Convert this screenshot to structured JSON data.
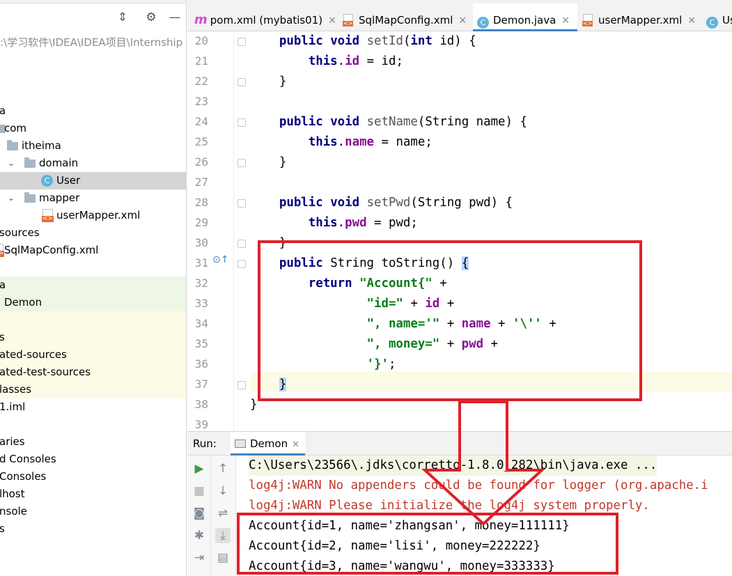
{
  "project": {
    "path": ":\\学习软件\\IDEA\\IDEA项目\\Internship p",
    "tree": [
      {
        "label": "a",
        "chev": "",
        "icon": "none"
      },
      {
        "label": "com",
        "chev": "",
        "icon": "folder"
      },
      {
        "label": "itheima",
        "chev": "",
        "icon": "folder"
      },
      {
        "label": "domain",
        "chev": "⌄",
        "icon": "folder"
      },
      {
        "label": "User",
        "chev": "",
        "icon": "class"
      },
      {
        "label": "mapper",
        "chev": "⌄",
        "icon": "folder"
      },
      {
        "label": "userMapper.xml",
        "chev": "",
        "icon": "xml"
      },
      {
        "label": "sources",
        "chev": "",
        "icon": "none"
      },
      {
        "label": "SqlMapConfig.xml",
        "chev": "",
        "icon": "xml"
      },
      {
        "label": "",
        "chev": "",
        "icon": "none"
      },
      {
        "label": "a",
        "chev": "",
        "icon": "none"
      },
      {
        "label": "Demon",
        "chev": "",
        "icon": "none"
      },
      {
        "label": "",
        "chev": "",
        "icon": "none"
      },
      {
        "label": "s",
        "chev": "",
        "icon": "none"
      },
      {
        "label": "ated-sources",
        "chev": "",
        "icon": "none"
      },
      {
        "label": "ated-test-sources",
        "chev": "",
        "icon": "none"
      },
      {
        "label": "lasses",
        "chev": "",
        "icon": "none"
      },
      {
        "label": "1.iml",
        "chev": "",
        "icon": "none"
      },
      {
        "label": "",
        "chev": "",
        "icon": "none"
      },
      {
        "label": "aries",
        "chev": "",
        "icon": "none"
      },
      {
        "label": "d Consoles",
        "chev": "",
        "icon": "none"
      },
      {
        "label": " Consoles",
        "chev": "",
        "icon": "none"
      },
      {
        "label": "lhost",
        "chev": "",
        "icon": "none"
      },
      {
        "label": "nsole",
        "chev": "",
        "icon": "none"
      },
      {
        "label": "s",
        "chev": "",
        "icon": "none"
      }
    ]
  },
  "tabs": [
    {
      "label": "pom.xml (mybatis01)",
      "icon": "maven"
    },
    {
      "label": "SqlMapConfig.xml",
      "icon": "xml"
    },
    {
      "label": "Demon.java",
      "icon": "class"
    },
    {
      "label": "userMapper.xml",
      "icon": "xml"
    },
    {
      "label": "Us",
      "icon": "class"
    }
  ],
  "editor": {
    "line_numbers": [
      "20",
      "21",
      "22",
      "23",
      "24",
      "25",
      "26",
      "27",
      "28",
      "29",
      "30",
      "31",
      "32",
      "33",
      "34",
      "35",
      "36",
      "37",
      "38",
      "39"
    ],
    "lines": [
      "    public void setId(int id) {",
      "        this.id = id;",
      "    }",
      "",
      "    public void setName(String name) {",
      "        this.name = name;",
      "    }",
      "",
      "    public void setPwd(String pwd) {",
      "        this.pwd = pwd;",
      "    }",
      "    public String toString() {",
      "        return \"Account{\" +",
      "                \"id=\" + id +",
      "                \", name='\" + name + '\\'' +",
      "                \", money=\" + pwd +",
      "                '}';",
      "    }",
      "}",
      ""
    ]
  },
  "run": {
    "label": "Run:",
    "tab": "Demon",
    "console": [
      {
        "text": "C:\\Users\\23566\\.jdks\\corretto-1.8.0_282\\bin\\java.exe ...",
        "kind": "cmd"
      },
      {
        "text": "log4j:WARN No appenders could be found for logger (org.apache.i",
        "kind": "warn"
      },
      {
        "text": "log4j:WARN Please initialize the log4j system properly.",
        "kind": "warn"
      },
      {
        "text": "Account{id=1, name='zhangsan', money=111111}",
        "kind": "out"
      },
      {
        "text": "Account{id=2, name='lisi', money=222222}",
        "kind": "out"
      },
      {
        "text": "Account{id=3, name='wangwu', money=333333}",
        "kind": "out"
      }
    ]
  },
  "colors": {
    "annotation_red": "#e0202a",
    "keyword": "#000080",
    "field": "#871094",
    "string": "#067d17",
    "warn": "#c0392b",
    "active_tab_underline": "#4083c9"
  }
}
